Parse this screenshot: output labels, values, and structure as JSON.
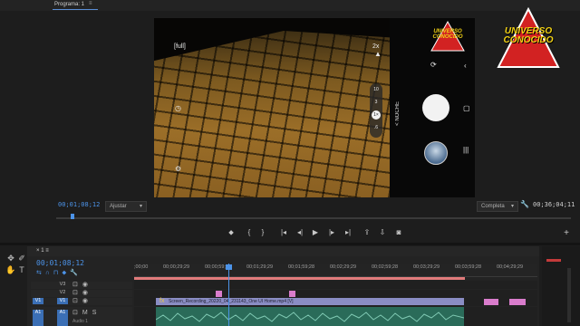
{
  "program": {
    "tab_label": "Programa: 1",
    "tab_menu_icon": "hamburger-icon"
  },
  "video": {
    "format_badge": "[full]",
    "zoom_top": "2x",
    "zoom_levels": [
      "10",
      "3",
      "1×",
      ".6"
    ],
    "night_label": "< NOCHE",
    "logo_line1": "UNIVERSO",
    "logo_line2": "CONOCIDO"
  },
  "overlay_logo": {
    "line1": "UNIVERSO",
    "line2": "CONOCIDO"
  },
  "monitor": {
    "current_timecode": "00;01;08;12",
    "fit_select": "Ajustar",
    "quality_select": "Completa",
    "duration_timecode": "00;36;04;11"
  },
  "transport": {
    "buttons": [
      "marker",
      "in",
      "out",
      "goto-in",
      "step-back",
      "play",
      "step-forward",
      "goto-out",
      "lift",
      "extract",
      "export-frame"
    ],
    "glyphs": [
      "⬥",
      "{",
      "}",
      "|◂",
      "◂|",
      "▶",
      "|▸",
      "▸|",
      "⇪",
      "⇩",
      "◙"
    ],
    "add_glyph": "+"
  },
  "timeline": {
    "sequence_name": "1",
    "close_glyph": "×",
    "current_timecode": "00;01;08;12",
    "ruler_labels": [
      ";00;00",
      "00;00;29;29",
      "00;00;59;28",
      "00;01;29;29",
      "00;01;59;28",
      "00;02;29;29",
      "00;02;59;28",
      "00;03;29;29",
      "00;03;59;28",
      "00;04;29;29"
    ],
    "tracks": [
      {
        "name": "V3",
        "target": ""
      },
      {
        "name": "V2",
        "target": ""
      },
      {
        "name": "V1",
        "target": "V1"
      },
      {
        "name": "A1",
        "target": "A1"
      }
    ],
    "clip_video_label": "Screen_Recording_20220_04_231143_One UI Home.mp4 [V]",
    "clip_fx": "fx",
    "audio_label": "Audio 1"
  },
  "tools": [
    "✥",
    "✐",
    "✋",
    "T"
  ],
  "colors": {
    "accent_blue": "#4c93e8",
    "clip_video": "#8a8dc4",
    "clip_audio": "#2a6b59",
    "marker_pink": "#d97ccc",
    "logo_red": "#d22222",
    "logo_yellow": "#f2d214"
  }
}
